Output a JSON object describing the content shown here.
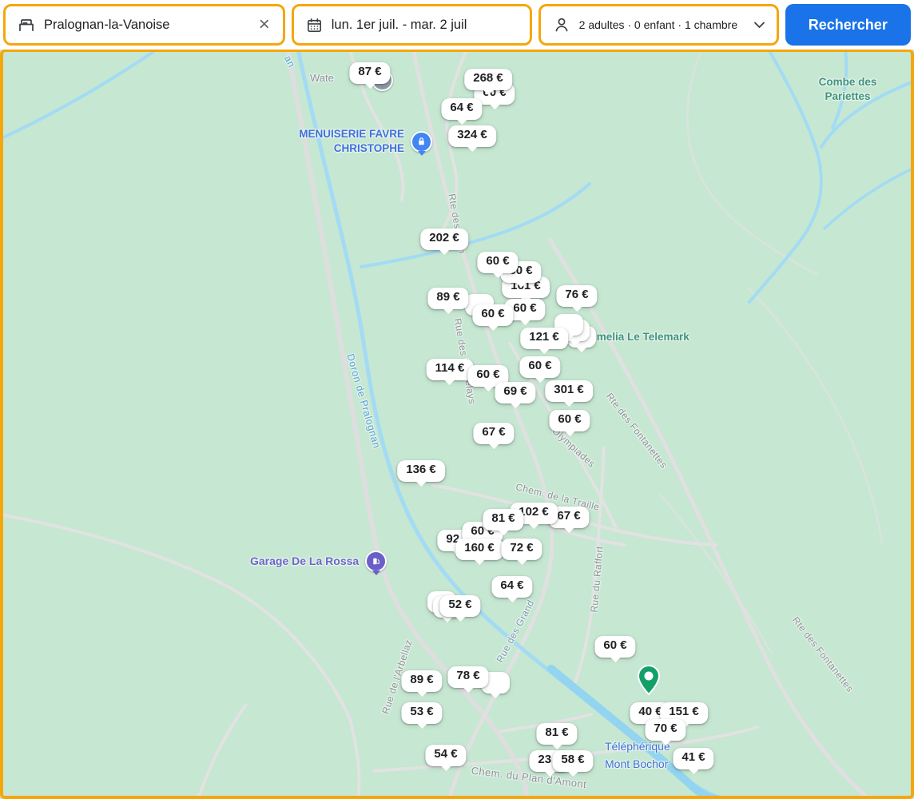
{
  "search_bar": {
    "destination": {
      "value": "Pralognan-la-Vanoise",
      "icon": "bed-icon",
      "clear_icon": "close-icon"
    },
    "dates": {
      "value": "lun. 1er juil. - mar. 2 juil",
      "icon": "calendar-icon"
    },
    "occupancy": {
      "value": "2 adultes · 0 enfant · 1 chambre",
      "icon": "person-icon",
      "chevron_icon": "chevron-down-icon"
    },
    "search_button": "Rechercher"
  },
  "map": {
    "markers": [
      {
        "label": "60 €"
      },
      {
        "label": "268 €"
      },
      {
        "label": "87 €"
      },
      {
        "label": "64 €"
      },
      {
        "label": "324 €"
      },
      {
        "label": "202 €"
      },
      {
        "label": "161 €"
      },
      {
        "label": "60 €"
      },
      {
        "label": "60 €"
      },
      {
        "label": "76 €"
      },
      {
        "label": ""
      },
      {
        "label": ""
      },
      {
        "label": ""
      },
      {
        "label": "121 €"
      },
      {
        "label": ""
      },
      {
        "label": "60 €"
      },
      {
        "label": "60 €"
      },
      {
        "label": "89 €"
      },
      {
        "label": "114 €"
      },
      {
        "label": "60 €"
      },
      {
        "label": "60 €"
      },
      {
        "label": "69 €"
      },
      {
        "label": "301 €"
      },
      {
        "label": "60 €"
      },
      {
        "label": "67 €"
      },
      {
        "label": "136 €"
      },
      {
        "label": "92 €"
      },
      {
        "label": "60 €"
      },
      {
        "label": "67 €"
      },
      {
        "label": "102 €"
      },
      {
        "label": "81 €"
      },
      {
        "label": "160 €"
      },
      {
        "label": "72 €"
      },
      {
        "label": "64 €"
      },
      {
        "label": ""
      },
      {
        "label": ""
      },
      {
        "label": "52 €"
      },
      {
        "label": "60 €"
      },
      {
        "label": ""
      },
      {
        "label": "78 €"
      },
      {
        "label": "89 €"
      },
      {
        "label": "53 €"
      },
      {
        "label": "54 €"
      },
      {
        "label": "40 €"
      },
      {
        "label": "151 €"
      },
      {
        "label": "70 €"
      },
      {
        "label": "81 €"
      },
      {
        "label": "23 €"
      },
      {
        "label": "58 €"
      },
      {
        "label": "41 €"
      }
    ],
    "poi_labels": {
      "waterfall": {
        "text": "Wate"
      },
      "menuiserie": {
        "line1": "MENUISERIE FAVRE",
        "line2": "CHRISTOPHE"
      },
      "combe": {
        "line1": "Combe des",
        "line2": "Pariettes"
      },
      "amelia": {
        "text": "Amelia Le Telemark"
      },
      "garage": {
        "text": "Garage De La Rossa"
      },
      "telepherique": {
        "line1": "Téléphérique",
        "line2": "Mont Bochor"
      }
    },
    "road_labels": {
      "granges_top": {
        "text": "Rte des Gran"
      },
      "darbelays": {
        "text": "Rue des Darbelays"
      },
      "fontanettes1": {
        "text": "Rte des Fontanettes"
      },
      "fontanettes2": {
        "text": "Rte des Fontanettes"
      },
      "traille": {
        "text": "Chem. de la Traille"
      },
      "olympiades": {
        "text": "Olympiades"
      },
      "raffort": {
        "text": "Rue du Raffort"
      },
      "grandes_low": {
        "text": "Rue des Grand"
      },
      "arbellaz": {
        "text": "Rue de l'Arbellaz"
      },
      "plan_amont": {
        "text": "Chem. du Plan d'Amont"
      }
    },
    "water_labels": {
      "doron_frag": {
        "text": "an"
      },
      "doron": {
        "text": "Doron de Pralognan"
      }
    }
  },
  "colors": {
    "accent_border": "#F4A70C",
    "search_button_blue": "#1A73E8",
    "map_background": "#C6E7D2",
    "water": "#A3DBF4",
    "road": "#E0E0E0",
    "price_text": "#202124",
    "poi_label_blue": "#3F71DC",
    "poi_label_purple": "#6C66CB",
    "nature_label_green": "#41947E",
    "road_label_gray": "#8F9398",
    "water_label_blue": "#52A3D6",
    "green_pin": "#12A06A",
    "blue_pin": "#4285F4",
    "purple_pin": "#6A5FC9",
    "gray_poi": "#8D99A5"
  }
}
